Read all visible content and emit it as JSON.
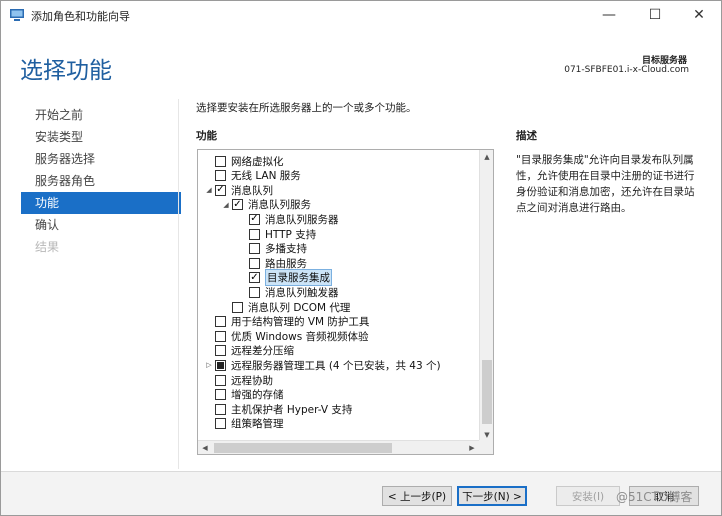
{
  "window": {
    "title": "添加角色和功能向导",
    "controls": {
      "minimize": "—",
      "maximize": "☐",
      "close": "✕"
    }
  },
  "header": {
    "page_title": "选择功能",
    "target_label": "目标服务器",
    "target_server": "071-SFBFE01.i-x-Cloud.com"
  },
  "nav": {
    "items": [
      {
        "label": "开始之前",
        "state": "normal"
      },
      {
        "label": "安装类型",
        "state": "normal"
      },
      {
        "label": "服务器选择",
        "state": "normal"
      },
      {
        "label": "服务器角色",
        "state": "normal"
      },
      {
        "label": "功能",
        "state": "active"
      },
      {
        "label": "确认",
        "state": "normal"
      },
      {
        "label": "结果",
        "state": "disabled"
      }
    ]
  },
  "main": {
    "instruction": "选择要安装在所选服务器上的一个或多个功能。",
    "features_header": "功能",
    "description_header": "描述",
    "description": "\"目录服务集成\"允许向目录发布队列属性，允许使用在目录中注册的证书进行身份验证和消息加密，还允许在目录站点之间对消息进行路由。",
    "tree": [
      {
        "label": "网络虚拟化",
        "level": 0,
        "expander": "",
        "checked": "none"
      },
      {
        "label": "无线 LAN 服务",
        "level": 0,
        "expander": "",
        "checked": "none"
      },
      {
        "label": "消息队列",
        "level": 0,
        "expander": "◢",
        "checked": "checked"
      },
      {
        "label": "消息队列服务",
        "level": 1,
        "expander": "◢",
        "checked": "checked"
      },
      {
        "label": "消息队列服务器",
        "level": 2,
        "expander": "",
        "checked": "checked"
      },
      {
        "label": "HTTP 支持",
        "level": 2,
        "expander": "",
        "checked": "none"
      },
      {
        "label": "多播支持",
        "level": 2,
        "expander": "",
        "checked": "none"
      },
      {
        "label": "路由服务",
        "level": 2,
        "expander": "",
        "checked": "none"
      },
      {
        "label": "目录服务集成",
        "level": 2,
        "expander": "",
        "checked": "checked",
        "selected": true
      },
      {
        "label": "消息队列触发器",
        "level": 2,
        "expander": "",
        "checked": "none"
      },
      {
        "label": "消息队列 DCOM 代理",
        "level": 1,
        "expander": "",
        "checked": "none"
      },
      {
        "label": "用于结构管理的 VM 防护工具",
        "level": 0,
        "expander": "",
        "checked": "none"
      },
      {
        "label": "优质 Windows 音频视频体验",
        "level": 0,
        "expander": "",
        "checked": "none"
      },
      {
        "label": "远程差分压缩",
        "level": 0,
        "expander": "",
        "checked": "none"
      },
      {
        "label": "远程服务器管理工具 (4 个已安装，共 43 个)",
        "level": 0,
        "expander": "▷",
        "checked": "partial"
      },
      {
        "label": "远程协助",
        "level": 0,
        "expander": "",
        "checked": "none"
      },
      {
        "label": "增强的存储",
        "level": 0,
        "expander": "",
        "checked": "none"
      },
      {
        "label": "主机保护者 Hyper-V 支持",
        "level": 0,
        "expander": "",
        "checked": "none"
      },
      {
        "label": "组策略管理",
        "level": 0,
        "expander": "",
        "checked": "none"
      }
    ]
  },
  "scrollbars": {
    "up": "▲",
    "down": "▼",
    "left": "◀",
    "right": "▶"
  },
  "footer": {
    "prev": "< 上一步(P)",
    "next": "下一步(N) >",
    "install": "安装(I)",
    "cancel": "取消"
  },
  "watermark": "@51CTO博客"
}
